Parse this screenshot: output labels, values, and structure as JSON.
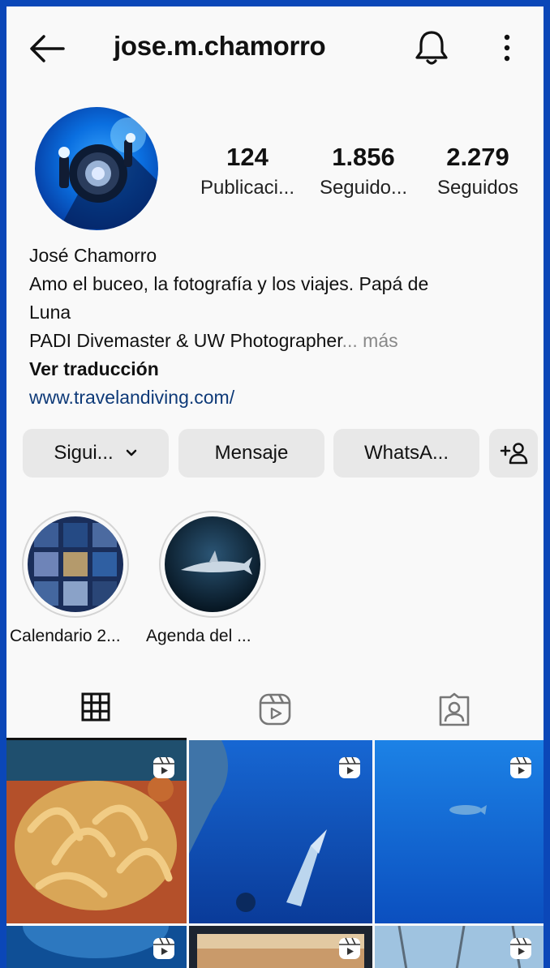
{
  "profile": {
    "username": "jose.m.chamorro",
    "stats": [
      {
        "value": "124",
        "label": "Publicaci..."
      },
      {
        "value": "1.856",
        "label": "Seguido..."
      },
      {
        "value": "2.279",
        "label": "Seguidos"
      }
    ],
    "bio": {
      "name": "José Chamorro",
      "line1": "Amo el buceo, la fotografía y los viajes. Papá de",
      "line2": "Luna",
      "line3": "PADI Divemaster & UW Photographer",
      "more": "... más",
      "translate": "Ver traducción",
      "link": "www.travelandiving.com/"
    }
  },
  "buttons": {
    "follow": "Sigui...",
    "message": "Mensaje",
    "whatsapp": "WhatsA..."
  },
  "highlights": [
    {
      "label": "Calendario 2..."
    },
    {
      "label": "Agenda del ..."
    }
  ],
  "tabs": [
    "grid-icon",
    "reels-icon",
    "tagged-icon"
  ],
  "grid": {
    "columns": 3,
    "visible_posts": 6,
    "type": "reel"
  },
  "colors": {
    "frame": "#0b47b8",
    "background": "#f9f9f9",
    "button": "#e8e8e8",
    "link": "#0e3a78"
  }
}
